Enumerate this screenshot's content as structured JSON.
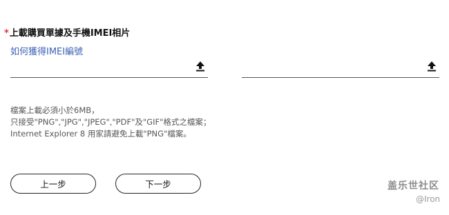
{
  "form": {
    "required_mark": "*",
    "title": "上載購買單據及手機IMEI相片",
    "help_link": "如何獲得IMEI編號",
    "upload_icon": "upload-arrow-icon"
  },
  "notes": {
    "line1": "檔案上載必須小於6MB，",
    "line2": "只接受\"PNG\",\"JPG\",\"JPEG\",\"PDF\"及\"GIF\"格式之檔案；",
    "line3": "Internet Explorer 8 用家請避免上載\"PNG\"檔案。"
  },
  "buttons": {
    "prev": "上一步",
    "next": "下一步"
  },
  "watermark": {
    "brand": "盖乐世社区",
    "user": "@Iron"
  },
  "colors": {
    "required": "#e0322e",
    "link": "#3a62b4"
  }
}
